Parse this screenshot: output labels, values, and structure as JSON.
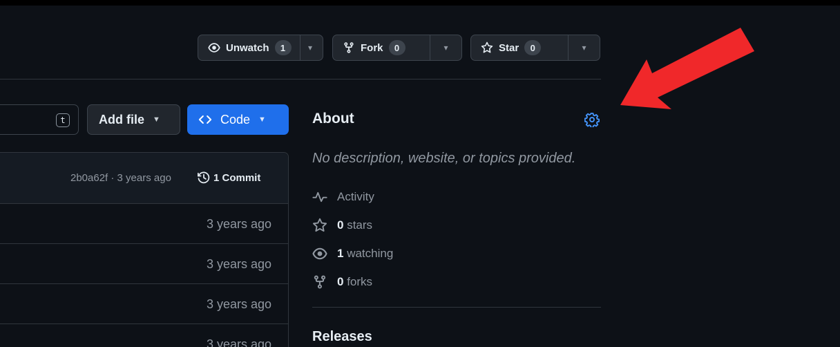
{
  "header": {
    "unwatch": {
      "label": "Unwatch",
      "count": "1"
    },
    "fork": {
      "label": "Fork",
      "count": "0"
    },
    "star": {
      "label": "Star",
      "count": "0"
    }
  },
  "toolbar": {
    "goto_shortcut": "t",
    "add_file_label": "Add file",
    "code_label": "Code"
  },
  "files": {
    "latest_commit_meta": "2b0a62f · 3 years ago",
    "commit_count_label": "1 Commit",
    "rows": [
      {
        "time": "3 years ago"
      },
      {
        "time": "3 years ago"
      },
      {
        "time": "3 years ago"
      },
      {
        "time": "3 years ago"
      }
    ]
  },
  "about": {
    "title": "About",
    "description": "No description, website, or topics provided.",
    "activity_label": "Activity",
    "stars_count": "0",
    "stars_label": "stars",
    "watching_count": "1",
    "watching_label": "watching",
    "forks_count": "0",
    "forks_label": "forks",
    "releases_title": "Releases"
  },
  "colors": {
    "background": "#0d1117",
    "code_button": "#1f6feb",
    "gear_accent": "#4493f8",
    "annotation_arrow": "#f0282a"
  },
  "icons": [
    "eye-icon",
    "fork-icon",
    "star-icon",
    "chevron-down-icon",
    "code-icon",
    "history-icon",
    "gear-icon",
    "pulse-icon"
  ]
}
